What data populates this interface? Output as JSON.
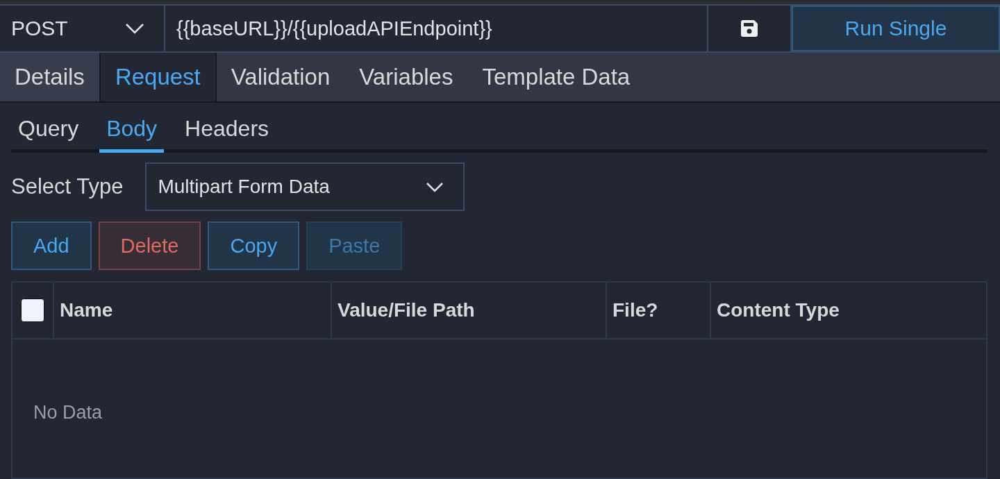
{
  "request_bar": {
    "method": "POST",
    "url": "{{baseURL}}/{{uploadAPIEndpoint}}",
    "run_button": "Run Single"
  },
  "tabs": [
    {
      "label": "Details",
      "selected": false,
      "hovered": true
    },
    {
      "label": "Request",
      "selected": true,
      "hovered": false
    },
    {
      "label": "Validation",
      "selected": false,
      "hovered": false
    },
    {
      "label": "Variables",
      "selected": false,
      "hovered": false
    },
    {
      "label": "Template Data",
      "selected": false,
      "hovered": false
    }
  ],
  "sub_tabs": [
    {
      "label": "Query",
      "selected": false
    },
    {
      "label": "Body",
      "selected": true
    },
    {
      "label": "Headers",
      "selected": false
    }
  ],
  "body_type": {
    "label": "Select Type",
    "value": "Multipart Form Data"
  },
  "actions": [
    {
      "label": "Add",
      "kind": "primary",
      "disabled": false
    },
    {
      "label": "Delete",
      "kind": "danger",
      "disabled": false
    },
    {
      "label": "Copy",
      "kind": "primary",
      "disabled": false
    },
    {
      "label": "Paste",
      "kind": "primary",
      "disabled": true
    }
  ],
  "table": {
    "select_all_checked": false,
    "columns": [
      "Name",
      "Value/File Path",
      "File?",
      "Content Type"
    ],
    "empty_text": "No Data"
  }
}
